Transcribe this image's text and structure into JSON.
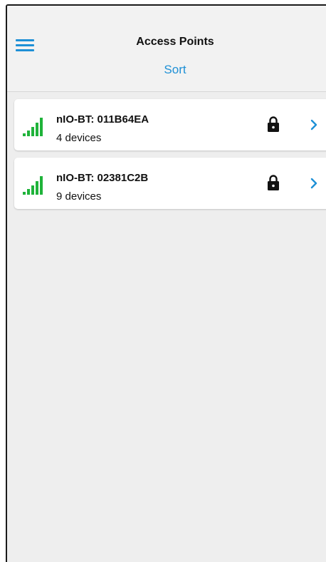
{
  "header": {
    "title": "Access Points",
    "sort_label": "Sort"
  },
  "colors": {
    "accent": "#1e90d6",
    "signal": "#1fb33a"
  },
  "access_points": [
    {
      "name": "nIO-BT: 011B64EA",
      "devices": "4 devices",
      "secured": true,
      "signal_icon": "signal-strength-icon"
    },
    {
      "name": "nIO-BT: 02381C2B",
      "devices": "9 devices",
      "secured": true,
      "signal_icon": "signal-strength-icon"
    }
  ]
}
